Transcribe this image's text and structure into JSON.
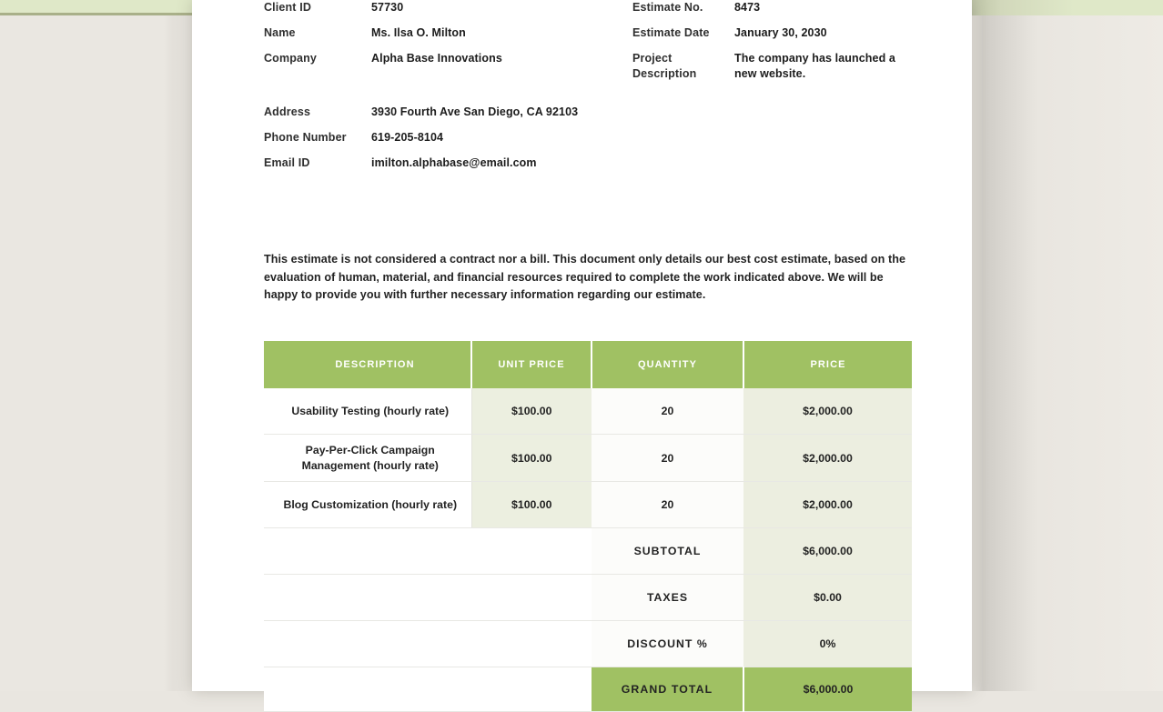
{
  "document": {
    "client_info": [
      {
        "label": "Client ID",
        "value": "57730"
      },
      {
        "label": "Name",
        "value": "Ms. Ilsa O. Milton"
      },
      {
        "label": "Company",
        "value": "Alpha Base Innovations"
      }
    ],
    "contact_info": [
      {
        "label": "Address",
        "value": "3930 Fourth Ave San Diego, CA 92103"
      },
      {
        "label": "Phone Number",
        "value": "619-205-8104"
      },
      {
        "label": "Email ID",
        "value": "imilton.alphabase@email.com"
      }
    ],
    "estimate_info": [
      {
        "label": "Estimate No.",
        "value": "8473"
      },
      {
        "label": "Estimate Date",
        "value": "January 30, 2030"
      },
      {
        "label": "Project Description",
        "value": "The company has launched a new website."
      }
    ],
    "disclaimer": "This estimate is not considered a contract nor a bill. This document only details our best cost estimate, based on the evaluation of human, material, and financial resources required to complete the work indicated above. We will be happy to provide you with further necessary information regarding our estimate.",
    "table": {
      "headers": {
        "description": "DESCRIPTION",
        "unit_price": "UNIT PRICE",
        "quantity": "QUANTITY",
        "price": "PRICE"
      },
      "rows": [
        {
          "description": "Usability Testing (hourly rate)",
          "unit_price": "$100.00",
          "quantity": "20",
          "price": "$2,000.00"
        },
        {
          "description": "Pay-Per-Click Campaign Management (hourly rate)",
          "unit_price": "$100.00",
          "quantity": "20",
          "price": "$2,000.00"
        },
        {
          "description": "Blog Customization (hourly rate)",
          "unit_price": "$100.00",
          "quantity": "20",
          "price": "$2,000.00"
        }
      ],
      "totals": [
        {
          "label": "SUBTOTAL",
          "value": "$6,000.00"
        },
        {
          "label": "TAXES",
          "value": "$0.00"
        },
        {
          "label": "DISCOUNT %",
          "value": "0%"
        }
      ],
      "grand_total": {
        "label": "GRAND TOTAL",
        "value": "$6,000.00"
      }
    },
    "colors": {
      "accent_green": "#a0c163",
      "strip_green": "#dfe8c8",
      "tint_row": "#eceee0",
      "page_background": "#e6e3dd"
    }
  }
}
